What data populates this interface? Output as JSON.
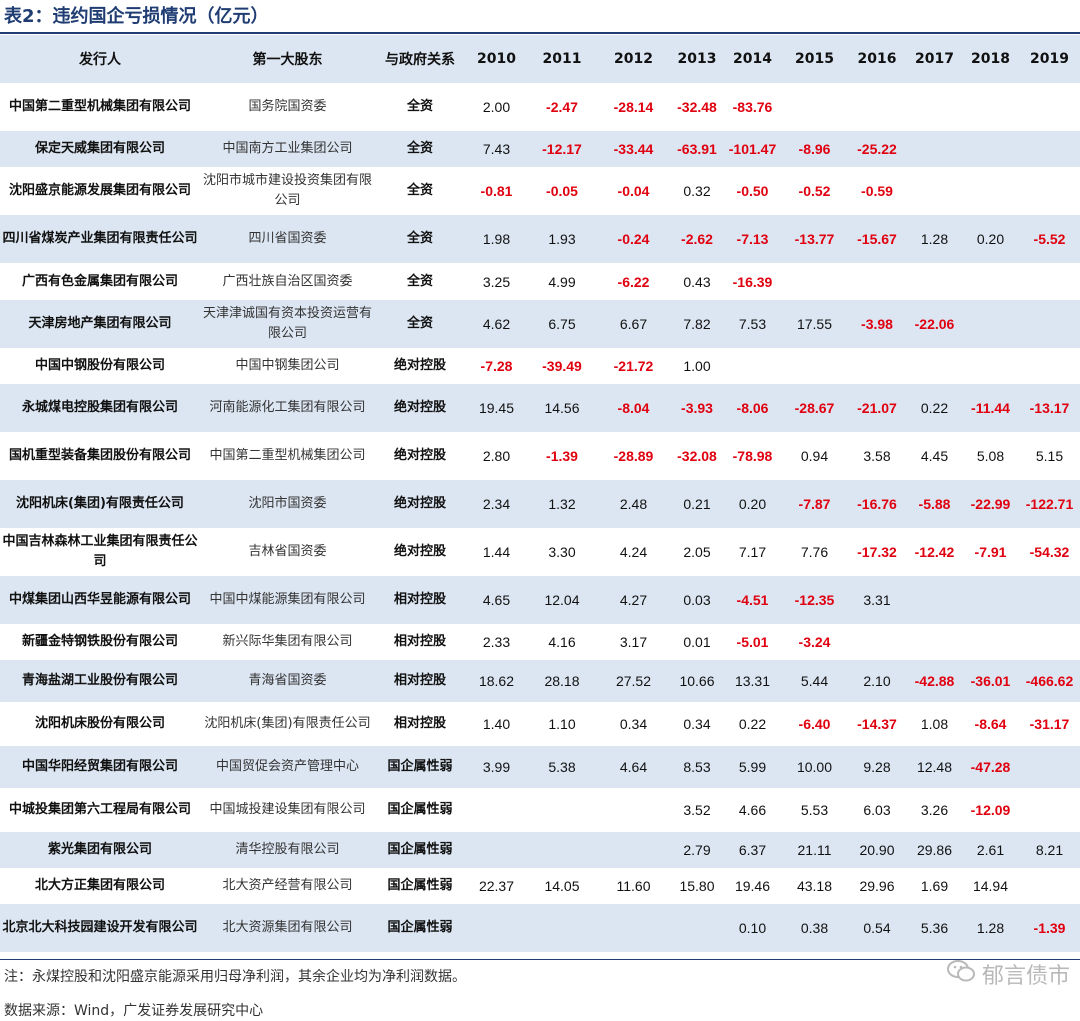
{
  "title": "表2：违约国企亏损情况（亿元）",
  "chart_data": {
    "type": "table",
    "columns": [
      "发行人",
      "第一大股东",
      "与政府关系",
      "2010",
      "2011",
      "2012",
      "2013",
      "2014",
      "2015",
      "2016",
      "2017",
      "2018",
      "2019"
    ],
    "rows": [
      {
        "issuer": "中国第二重型机械集团有限公司",
        "holder": "国务院国资委",
        "relation": "全资",
        "values": [
          "2.00",
          "-2.47",
          "-28.14",
          "-32.48",
          "-83.76",
          "",
          "",
          "",
          "",
          ""
        ]
      },
      {
        "issuer": "保定天威集团有限公司",
        "holder": "中国南方工业集团公司",
        "relation": "全资",
        "values": [
          "7.43",
          "-12.17",
          "-33.44",
          "-63.91",
          "-101.47",
          "-8.96",
          "-25.22",
          "",
          "",
          ""
        ]
      },
      {
        "issuer": "沈阳盛京能源发展集团有限公司",
        "holder": "沈阳市城市建设投资集团有限公司",
        "relation": "全资",
        "values": [
          "-0.81",
          "-0.05",
          "-0.04",
          "0.32",
          "-0.50",
          "-0.52",
          "-0.59",
          "",
          "",
          ""
        ]
      },
      {
        "issuer": "四川省煤炭产业集团有限责任公司",
        "holder": "四川省国资委",
        "relation": "全资",
        "values": [
          "1.98",
          "1.93",
          "-0.24",
          "-2.62",
          "-7.13",
          "-13.77",
          "-15.67",
          "1.28",
          "0.20",
          "-5.52"
        ]
      },
      {
        "issuer": "广西有色金属集团有限公司",
        "holder": "广西壮族自治区国资委",
        "relation": "全资",
        "values": [
          "3.25",
          "4.99",
          "-6.22",
          "0.43",
          "-16.39",
          "",
          "",
          "",
          "",
          ""
        ]
      },
      {
        "issuer": "天津房地产集团有限公司",
        "holder": "天津津诚国有资本投资运营有限公司",
        "relation": "全资",
        "values": [
          "4.62",
          "6.75",
          "6.67",
          "7.82",
          "7.53",
          "17.55",
          "-3.98",
          "-22.06",
          "",
          ""
        ]
      },
      {
        "issuer": "中国中钢股份有限公司",
        "holder": "中国中钢集团公司",
        "relation": "绝对控股",
        "values": [
          "-7.28",
          "-39.49",
          "-21.72",
          "1.00",
          "",
          "",
          "",
          "",
          "",
          ""
        ]
      },
      {
        "issuer": "永城煤电控股集团有限公司",
        "holder": "河南能源化工集团有限公司",
        "relation": "绝对控股",
        "values": [
          "19.45",
          "14.56",
          "-8.04",
          "-3.93",
          "-8.06",
          "-28.67",
          "-21.07",
          "0.22",
          "-11.44",
          "-13.17"
        ]
      },
      {
        "issuer": "国机重型装备集团股份有限公司",
        "holder": "中国第二重型机械集团公司",
        "relation": "绝对控股",
        "values": [
          "2.80",
          "-1.39",
          "-28.89",
          "-32.08",
          "-78.98",
          "0.94",
          "3.58",
          "4.45",
          "5.08",
          "5.15"
        ]
      },
      {
        "issuer": "沈阳机床(集团)有限责任公司",
        "holder": "沈阳市国资委",
        "relation": "绝对控股",
        "values": [
          "2.34",
          "1.32",
          "2.48",
          "0.21",
          "0.20",
          "-7.87",
          "-16.76",
          "-5.88",
          "-22.99",
          "-122.71"
        ]
      },
      {
        "issuer": "中国吉林森林工业集团有限责任公司",
        "holder": "吉林省国资委",
        "relation": "绝对控股",
        "values": [
          "1.44",
          "3.30",
          "4.24",
          "2.05",
          "7.17",
          "7.76",
          "-17.32",
          "-12.42",
          "-7.91",
          "-54.32"
        ]
      },
      {
        "issuer": "中煤集团山西华昱能源有限公司",
        "holder": "中国中煤能源集团有限公司",
        "relation": "相对控股",
        "values": [
          "4.65",
          "12.04",
          "4.27",
          "0.03",
          "-4.51",
          "-12.35",
          "3.31",
          "",
          "",
          ""
        ]
      },
      {
        "issuer": "新疆金特钢铁股份有限公司",
        "holder": "新兴际华集团有限公司",
        "relation": "相对控股",
        "values": [
          "2.33",
          "4.16",
          "3.17",
          "0.01",
          "-5.01",
          "-3.24",
          "",
          "",
          "",
          ""
        ]
      },
      {
        "issuer": "青海盐湖工业股份有限公司",
        "holder": "青海省国资委",
        "relation": "相对控股",
        "values": [
          "18.62",
          "28.18",
          "27.52",
          "10.66",
          "13.31",
          "5.44",
          "2.10",
          "-42.88",
          "-36.01",
          "-466.62"
        ]
      },
      {
        "issuer": "沈阳机床股份有限公司",
        "holder": "沈阳机床(集团)有限责任公司",
        "relation": "相对控股",
        "values": [
          "1.40",
          "1.10",
          "0.34",
          "0.34",
          "0.22",
          "-6.40",
          "-14.37",
          "1.08",
          "-8.64",
          "-31.17"
        ]
      },
      {
        "issuer": "中国华阳经贸集团有限公司",
        "holder": "中国贸促会资产管理中心",
        "relation": "国企属性弱",
        "values": [
          "3.99",
          "5.38",
          "4.64",
          "8.53",
          "5.99",
          "10.00",
          "9.28",
          "12.48",
          "-47.28",
          ""
        ]
      },
      {
        "issuer": "中城投集团第六工程局有限公司",
        "holder": "中国城投建设集团有限公司",
        "relation": "国企属性弱",
        "values": [
          "",
          "",
          "",
          "3.52",
          "4.66",
          "5.53",
          "6.03",
          "3.26",
          "-12.09",
          ""
        ]
      },
      {
        "issuer": "紫光集团有限公司",
        "holder": "清华控股有限公司",
        "relation": "国企属性弱",
        "values": [
          "",
          "",
          "",
          "2.79",
          "6.37",
          "21.11",
          "20.90",
          "29.86",
          "2.61",
          "8.21"
        ]
      },
      {
        "issuer": "北大方正集团有限公司",
        "holder": "北大资产经营有限公司",
        "relation": "国企属性弱",
        "values": [
          "22.37",
          "14.05",
          "11.60",
          "15.80",
          "19.46",
          "43.18",
          "29.96",
          "1.69",
          "14.94",
          ""
        ]
      },
      {
        "issuer": "北京北大科技园建设开发有限公司",
        "holder": "北大资源集团有限公司",
        "relation": "国企属性弱",
        "values": [
          "",
          "",
          "",
          "",
          "0.10",
          "0.38",
          "0.54",
          "5.36",
          "1.28",
          "-1.39"
        ]
      }
    ]
  },
  "note": "注：永煤控股和沈阳盛京能源采用归母净利润，其余企业均为净利润数据。",
  "source": "数据来源：Wind，广发证券发展研究中心",
  "watermark": "郁言债市",
  "icons": {
    "watermark": "wechat-icon"
  },
  "colors": {
    "title": "#1f3c73",
    "header_bg": "#dce6f2",
    "stripe_bg": "#dce6f2",
    "negative": "#e0000f"
  }
}
